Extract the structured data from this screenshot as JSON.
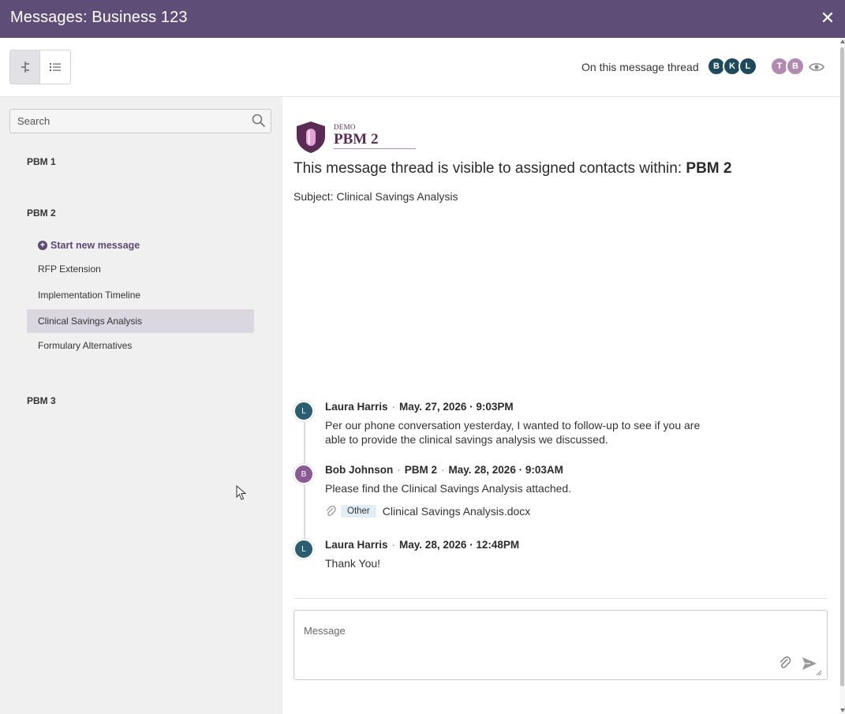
{
  "window": {
    "title": "Messages: Business 123",
    "close_glyph": "✕"
  },
  "toolbar": {
    "views": [
      {
        "name": "tree-view",
        "icon": "tree-icon",
        "active": true
      },
      {
        "name": "list-view",
        "icon": "list-icon",
        "active": false
      }
    ],
    "participants_label": "On this message thread",
    "contacts_primary": [
      "B",
      "K",
      "L"
    ],
    "contacts_secondary": [
      "T",
      "B"
    ],
    "watchers_icon": "eye-icon"
  },
  "sidebar": {
    "search_placeholder": "Search",
    "groups": [
      {
        "title": "PBM 1"
      },
      {
        "title": "PBM 2"
      },
      {
        "title": "PBM 3"
      }
    ],
    "start_new_label": "Start new message",
    "threads": [
      {
        "label": "RFP Extension",
        "selected": false
      },
      {
        "label": "Implementation Timeline",
        "selected": false
      },
      {
        "label": "Clinical Savings Analysis",
        "selected": true
      },
      {
        "label": "Formulary Alternatives",
        "selected": false
      }
    ]
  },
  "main": {
    "logo": {
      "demo": "DEMO",
      "name": "PBM 2"
    },
    "visibility_prefix": "This message thread is visible to assigned contacts within: ",
    "visibility_org": "PBM 2",
    "subject": "Subject: Clinical Savings Analysis",
    "messages": [
      {
        "initial": "L",
        "author": "Laura Harris",
        "org": "",
        "date": "May. 27, 2026 · 9:03PM",
        "body": "Per our phone conversation yesterday, I wanted to follow-up to see if you are able to provide the clinical savings analysis we discussed."
      },
      {
        "initial": "B",
        "author": "Bob Johnson",
        "org": "PBM 2",
        "date": "May. 28, 2026 · 9:03AM",
        "body": "Please find the Clinical Savings Analysis attached.",
        "attachment": {
          "tag": "Other",
          "file": "Clinical Savings Analysis.docx"
        }
      },
      {
        "initial": "L",
        "author": "Laura Harris",
        "org": "",
        "date": "May. 28, 2026 · 12:48PM",
        "body": "Thank You!"
      }
    ],
    "composer": {
      "placeholder": "Message"
    }
  },
  "colors": {
    "header": "#5d4d77",
    "accent": "#5a4a72",
    "selected_row": "#dad7e0",
    "sidebar_bg": "#f0f0f1"
  }
}
